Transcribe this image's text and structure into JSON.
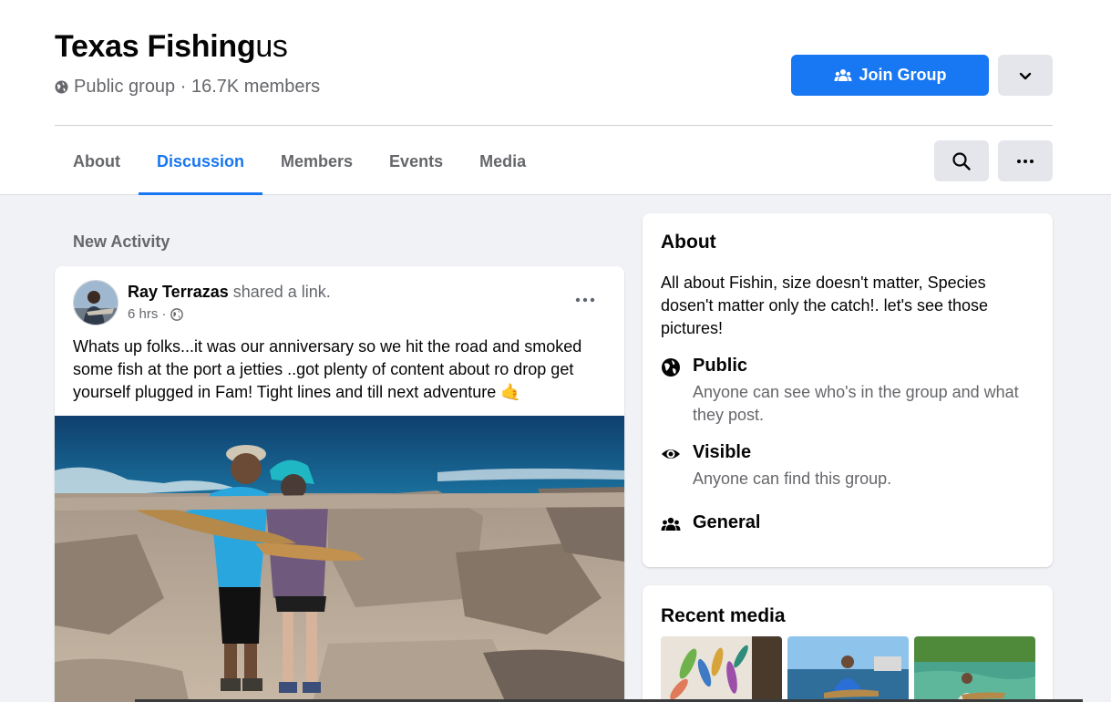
{
  "group": {
    "title_main": "Texas Fishing",
    "title_tail": "us",
    "meta": "Public group · 16.7K members"
  },
  "actions": {
    "join_label": "Join Group"
  },
  "tabs": [
    {
      "label": "About"
    },
    {
      "label": "Discussion"
    },
    {
      "label": "Members"
    },
    {
      "label": "Events"
    },
    {
      "label": "Media"
    }
  ],
  "feed": {
    "section_label": "New Activity",
    "post": {
      "author": "Ray Terrazas",
      "action": " shared a link.",
      "time": "6 hrs ·",
      "text": "Whats up folks...it was our anniversary so we hit the road and smoked some fish at the port a jetties ..got plenty of content about ro drop get yourself plugged in Fam! Tight lines and till next adventure 🤙"
    }
  },
  "about": {
    "title": "About",
    "description": "All about Fishin, size doesn't matter, Species dosen't matter only the catch!. let's see those pictures!",
    "items": [
      {
        "icon": "globe-icon",
        "title": "Public",
        "subtitle": "Anyone can see who's in the group and what they post."
      },
      {
        "icon": "eye-icon",
        "title": "Visible",
        "subtitle": "Anyone can find this group."
      },
      {
        "icon": "people-icon",
        "title": "General",
        "subtitle": ""
      }
    ]
  },
  "recent_media": {
    "title": "Recent media"
  },
  "colors": {
    "accent": "#1877f2",
    "background": "#f0f2f5",
    "secondary_text": "#65676b"
  }
}
